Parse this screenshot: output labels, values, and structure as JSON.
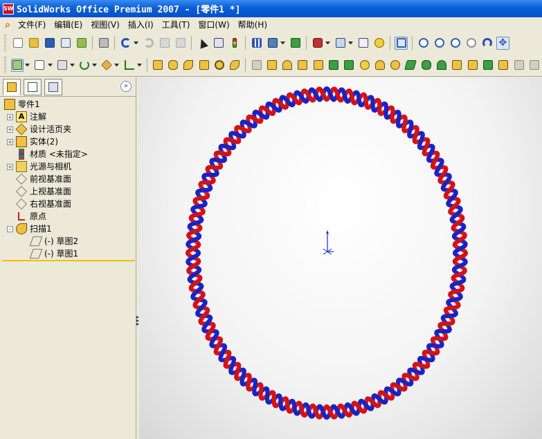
{
  "window": {
    "title": "SolidWorks Office Premium 2007 - [零件1 *]",
    "icon": "SW"
  },
  "menu": {
    "items": [
      "文件(F)",
      "编辑(E)",
      "视图(V)",
      "插入(I)",
      "工具(T)",
      "窗口(W)",
      "帮助(H)"
    ]
  },
  "toolbar_top": {
    "icons": [
      "new-icon",
      "open-icon",
      "save-icon",
      "print-preview-icon",
      "publish-icon",
      "print-icon",
      "undo-icon",
      "redo-icon",
      "copy-icon",
      "paste-icon",
      "select-icon",
      "select-other-icon",
      "traffic-light-icon",
      "grid-icon",
      "options-icon",
      "rebuild-icon",
      "display-style-icon",
      "view-orientation-icon",
      "properties-icon",
      "help-icon",
      "select-filter-icon",
      "zoom-fit-icon",
      "zoom-area-icon",
      "zoom-in-out-icon",
      "zoom-selection-icon",
      "rotate-icon",
      "pan-icon"
    ]
  },
  "toolbar_features": {
    "icons": [
      "sketch-icon",
      "smart-dimension-icon",
      "reference-geometry-icon",
      "curves-icon",
      "instant3d-icon",
      "measure-icon",
      "extrude-boss-icon",
      "revolve-boss-icon",
      "sweep-icon",
      "loft-icon",
      "extruded-cut-icon",
      "revolved-cut-icon",
      "swept-cut-icon",
      "lofted-cut-icon",
      "fillet-icon",
      "chamfer-icon",
      "rib-icon",
      "shell-icon",
      "draft-icon",
      "hole-icon",
      "dome-icon",
      "shape-icon",
      "flex-icon",
      "wrap-icon",
      "freeform-icon",
      "deform-icon",
      "indent-icon",
      "intersect-icon",
      "split-icon",
      "combine-icon",
      "cavity-icon",
      "scale-icon"
    ]
  },
  "panel": {
    "tabs": [
      "featuremanager-tab",
      "propertymanager-tab",
      "configurationmanager-tab"
    ],
    "tree": [
      {
        "label": "零件1",
        "icon": "part-icon",
        "level": 0,
        "expander": ""
      },
      {
        "label": "注解",
        "icon": "annotations-icon",
        "level": 1,
        "expander": "+"
      },
      {
        "label": "设计活页夹",
        "icon": "design-binder-icon",
        "level": 1,
        "expander": "+"
      },
      {
        "label": "实体(2)",
        "icon": "solid-bodies-icon",
        "level": 1,
        "expander": "+"
      },
      {
        "label": "材质 <未指定>",
        "icon": "material-icon",
        "level": 1,
        "expander": ""
      },
      {
        "label": "光源与相机",
        "icon": "lights-cameras-icon",
        "level": 1,
        "expander": "+"
      },
      {
        "label": "前视基准面",
        "icon": "plane-icon",
        "level": 1,
        "expander": ""
      },
      {
        "label": "上视基准面",
        "icon": "plane-icon",
        "level": 1,
        "expander": ""
      },
      {
        "label": "右视基准面",
        "icon": "plane-icon",
        "level": 1,
        "expander": ""
      },
      {
        "label": "原点",
        "icon": "origin-icon",
        "level": 1,
        "expander": ""
      },
      {
        "label": "扫描1",
        "icon": "sweep-feature-icon",
        "level": 1,
        "expander": "-"
      },
      {
        "label": "(-) 草图2",
        "icon": "sketch-icon",
        "level": 2,
        "expander": ""
      },
      {
        "label": "(-) 草图1",
        "icon": "sketch-icon",
        "level": 2,
        "expander": ""
      }
    ]
  },
  "model": {
    "strand_colors": [
      "#d31217",
      "#1c22c2"
    ],
    "twist_count": 58,
    "description_note": ""
  },
  "colors": {
    "title_blue": "#0a5fd8",
    "chrome": "#ece9d8",
    "rollback_bar": "#f0c000"
  }
}
